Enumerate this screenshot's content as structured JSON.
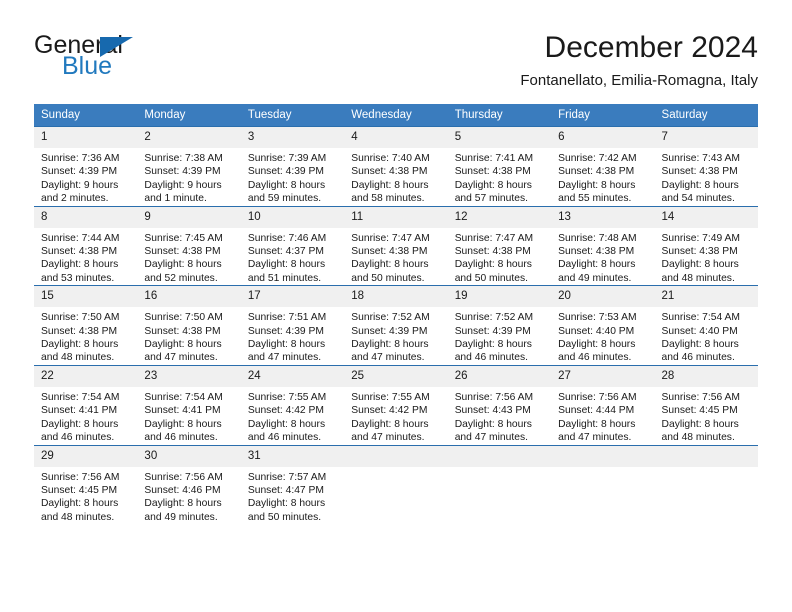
{
  "brand": {
    "name_part1": "General",
    "name_part2": "Blue",
    "triangle_color": "#1769ae",
    "blue_color": "#2179be"
  },
  "header": {
    "title": "December 2024",
    "subtitle": "Fontanellato, Emilia-Romagna, Italy"
  },
  "theme": {
    "header_row_bg": "#3a7cbe",
    "daynum_bg": "#f0f0f0",
    "row_border": "#2a6ead",
    "text": "#1a1a1a"
  },
  "weekday_headers": [
    "Sunday",
    "Monday",
    "Tuesday",
    "Wednesday",
    "Thursday",
    "Friday",
    "Saturday"
  ],
  "labels": {
    "sunrise_prefix": "Sunrise:",
    "sunset_prefix": "Sunset:",
    "daylight_prefix": "Daylight:"
  },
  "weeks": [
    [
      {
        "day": "1",
        "sunrise": "Sunrise: 7:36 AM",
        "sunset": "Sunset: 4:39 PM",
        "daylight_line1": "Daylight: 9 hours",
        "daylight_line2": "and 2 minutes."
      },
      {
        "day": "2",
        "sunrise": "Sunrise: 7:38 AM",
        "sunset": "Sunset: 4:39 PM",
        "daylight_line1": "Daylight: 9 hours",
        "daylight_line2": "and 1 minute."
      },
      {
        "day": "3",
        "sunrise": "Sunrise: 7:39 AM",
        "sunset": "Sunset: 4:39 PM",
        "daylight_line1": "Daylight: 8 hours",
        "daylight_line2": "and 59 minutes."
      },
      {
        "day": "4",
        "sunrise": "Sunrise: 7:40 AM",
        "sunset": "Sunset: 4:38 PM",
        "daylight_line1": "Daylight: 8 hours",
        "daylight_line2": "and 58 minutes."
      },
      {
        "day": "5",
        "sunrise": "Sunrise: 7:41 AM",
        "sunset": "Sunset: 4:38 PM",
        "daylight_line1": "Daylight: 8 hours",
        "daylight_line2": "and 57 minutes."
      },
      {
        "day": "6",
        "sunrise": "Sunrise: 7:42 AM",
        "sunset": "Sunset: 4:38 PM",
        "daylight_line1": "Daylight: 8 hours",
        "daylight_line2": "and 55 minutes."
      },
      {
        "day": "7",
        "sunrise": "Sunrise: 7:43 AM",
        "sunset": "Sunset: 4:38 PM",
        "daylight_line1": "Daylight: 8 hours",
        "daylight_line2": "and 54 minutes."
      }
    ],
    [
      {
        "day": "8",
        "sunrise": "Sunrise: 7:44 AM",
        "sunset": "Sunset: 4:38 PM",
        "daylight_line1": "Daylight: 8 hours",
        "daylight_line2": "and 53 minutes."
      },
      {
        "day": "9",
        "sunrise": "Sunrise: 7:45 AM",
        "sunset": "Sunset: 4:38 PM",
        "daylight_line1": "Daylight: 8 hours",
        "daylight_line2": "and 52 minutes."
      },
      {
        "day": "10",
        "sunrise": "Sunrise: 7:46 AM",
        "sunset": "Sunset: 4:37 PM",
        "daylight_line1": "Daylight: 8 hours",
        "daylight_line2": "and 51 minutes."
      },
      {
        "day": "11",
        "sunrise": "Sunrise: 7:47 AM",
        "sunset": "Sunset: 4:38 PM",
        "daylight_line1": "Daylight: 8 hours",
        "daylight_line2": "and 50 minutes."
      },
      {
        "day": "12",
        "sunrise": "Sunrise: 7:47 AM",
        "sunset": "Sunset: 4:38 PM",
        "daylight_line1": "Daylight: 8 hours",
        "daylight_line2": "and 50 minutes."
      },
      {
        "day": "13",
        "sunrise": "Sunrise: 7:48 AM",
        "sunset": "Sunset: 4:38 PM",
        "daylight_line1": "Daylight: 8 hours",
        "daylight_line2": "and 49 minutes."
      },
      {
        "day": "14",
        "sunrise": "Sunrise: 7:49 AM",
        "sunset": "Sunset: 4:38 PM",
        "daylight_line1": "Daylight: 8 hours",
        "daylight_line2": "and 48 minutes."
      }
    ],
    [
      {
        "day": "15",
        "sunrise": "Sunrise: 7:50 AM",
        "sunset": "Sunset: 4:38 PM",
        "daylight_line1": "Daylight: 8 hours",
        "daylight_line2": "and 48 minutes."
      },
      {
        "day": "16",
        "sunrise": "Sunrise: 7:50 AM",
        "sunset": "Sunset: 4:38 PM",
        "daylight_line1": "Daylight: 8 hours",
        "daylight_line2": "and 47 minutes."
      },
      {
        "day": "17",
        "sunrise": "Sunrise: 7:51 AM",
        "sunset": "Sunset: 4:39 PM",
        "daylight_line1": "Daylight: 8 hours",
        "daylight_line2": "and 47 minutes."
      },
      {
        "day": "18",
        "sunrise": "Sunrise: 7:52 AM",
        "sunset": "Sunset: 4:39 PM",
        "daylight_line1": "Daylight: 8 hours",
        "daylight_line2": "and 47 minutes."
      },
      {
        "day": "19",
        "sunrise": "Sunrise: 7:52 AM",
        "sunset": "Sunset: 4:39 PM",
        "daylight_line1": "Daylight: 8 hours",
        "daylight_line2": "and 46 minutes."
      },
      {
        "day": "20",
        "sunrise": "Sunrise: 7:53 AM",
        "sunset": "Sunset: 4:40 PM",
        "daylight_line1": "Daylight: 8 hours",
        "daylight_line2": "and 46 minutes."
      },
      {
        "day": "21",
        "sunrise": "Sunrise: 7:54 AM",
        "sunset": "Sunset: 4:40 PM",
        "daylight_line1": "Daylight: 8 hours",
        "daylight_line2": "and 46 minutes."
      }
    ],
    [
      {
        "day": "22",
        "sunrise": "Sunrise: 7:54 AM",
        "sunset": "Sunset: 4:41 PM",
        "daylight_line1": "Daylight: 8 hours",
        "daylight_line2": "and 46 minutes."
      },
      {
        "day": "23",
        "sunrise": "Sunrise: 7:54 AM",
        "sunset": "Sunset: 4:41 PM",
        "daylight_line1": "Daylight: 8 hours",
        "daylight_line2": "and 46 minutes."
      },
      {
        "day": "24",
        "sunrise": "Sunrise: 7:55 AM",
        "sunset": "Sunset: 4:42 PM",
        "daylight_line1": "Daylight: 8 hours",
        "daylight_line2": "and 46 minutes."
      },
      {
        "day": "25",
        "sunrise": "Sunrise: 7:55 AM",
        "sunset": "Sunset: 4:42 PM",
        "daylight_line1": "Daylight: 8 hours",
        "daylight_line2": "and 47 minutes."
      },
      {
        "day": "26",
        "sunrise": "Sunrise: 7:56 AM",
        "sunset": "Sunset: 4:43 PM",
        "daylight_line1": "Daylight: 8 hours",
        "daylight_line2": "and 47 minutes."
      },
      {
        "day": "27",
        "sunrise": "Sunrise: 7:56 AM",
        "sunset": "Sunset: 4:44 PM",
        "daylight_line1": "Daylight: 8 hours",
        "daylight_line2": "and 47 minutes."
      },
      {
        "day": "28",
        "sunrise": "Sunrise: 7:56 AM",
        "sunset": "Sunset: 4:45 PM",
        "daylight_line1": "Daylight: 8 hours",
        "daylight_line2": "and 48 minutes."
      }
    ],
    [
      {
        "day": "29",
        "sunrise": "Sunrise: 7:56 AM",
        "sunset": "Sunset: 4:45 PM",
        "daylight_line1": "Daylight: 8 hours",
        "daylight_line2": "and 48 minutes."
      },
      {
        "day": "30",
        "sunrise": "Sunrise: 7:56 AM",
        "sunset": "Sunset: 4:46 PM",
        "daylight_line1": "Daylight: 8 hours",
        "daylight_line2": "and 49 minutes."
      },
      {
        "day": "31",
        "sunrise": "Sunrise: 7:57 AM",
        "sunset": "Sunset: 4:47 PM",
        "daylight_line1": "Daylight: 8 hours",
        "daylight_line2": "and 50 minutes."
      },
      {
        "day": "",
        "sunrise": "",
        "sunset": "",
        "daylight_line1": "",
        "daylight_line2": ""
      },
      {
        "day": "",
        "sunrise": "",
        "sunset": "",
        "daylight_line1": "",
        "daylight_line2": ""
      },
      {
        "day": "",
        "sunrise": "",
        "sunset": "",
        "daylight_line1": "",
        "daylight_line2": ""
      },
      {
        "day": "",
        "sunrise": "",
        "sunset": "",
        "daylight_line1": "",
        "daylight_line2": ""
      }
    ]
  ]
}
